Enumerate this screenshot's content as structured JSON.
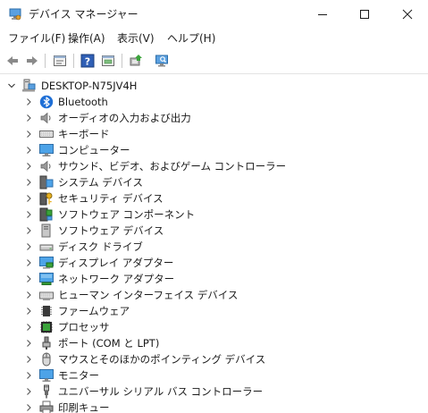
{
  "window": {
    "title": "デバイス マネージャー"
  },
  "menu": {
    "items": [
      {
        "label": "ファイル(F)"
      },
      {
        "label": "操作(A)"
      },
      {
        "label": "表示(V)"
      },
      {
        "label": "ヘルプ(H)"
      }
    ]
  },
  "toolbar": {
    "icons": [
      "back-arrow-icon",
      "forward-arrow-icon",
      "properties-icon",
      "help-icon",
      "show-hidden-icon",
      "update-driver-icon",
      "scan-hardware-icon"
    ]
  },
  "tree": {
    "root": {
      "label": "DESKTOP-N75JV4H",
      "icon": "computer-icon"
    },
    "items": [
      {
        "label": "Bluetooth",
        "icon": "bluetooth-icon"
      },
      {
        "label": "オーディオの入力および出力",
        "icon": "speaker-icon"
      },
      {
        "label": "キーボード",
        "icon": "keyboard-icon"
      },
      {
        "label": "コンピューター",
        "icon": "monitor-icon"
      },
      {
        "label": "サウンド、ビデオ、およびゲーム コントローラー",
        "icon": "speaker-icon"
      },
      {
        "label": "システム デバイス",
        "icon": "system-device-icon"
      },
      {
        "label": "セキュリティ デバイス",
        "icon": "security-key-icon"
      },
      {
        "label": "ソフトウェア コンポーネント",
        "icon": "software-component-icon"
      },
      {
        "label": "ソフトウェア デバイス",
        "icon": "software-device-icon"
      },
      {
        "label": "ディスク ドライブ",
        "icon": "disk-drive-icon"
      },
      {
        "label": "ディスプレイ アダプター",
        "icon": "display-adapter-icon"
      },
      {
        "label": "ネットワーク アダプター",
        "icon": "network-adapter-icon"
      },
      {
        "label": "ヒューマン インターフェイス デバイス",
        "icon": "hid-icon"
      },
      {
        "label": "ファームウェア",
        "icon": "firmware-icon"
      },
      {
        "label": "プロセッサ",
        "icon": "processor-icon"
      },
      {
        "label": "ポート (COM と LPT)",
        "icon": "port-icon"
      },
      {
        "label": "マウスとそのほかのポインティング デバイス",
        "icon": "mouse-icon"
      },
      {
        "label": "モニター",
        "icon": "monitor-icon"
      },
      {
        "label": "ユニバーサル シリアル バス コントローラー",
        "icon": "usb-icon"
      },
      {
        "label": "印刷キュー",
        "icon": "printer-icon"
      }
    ]
  }
}
